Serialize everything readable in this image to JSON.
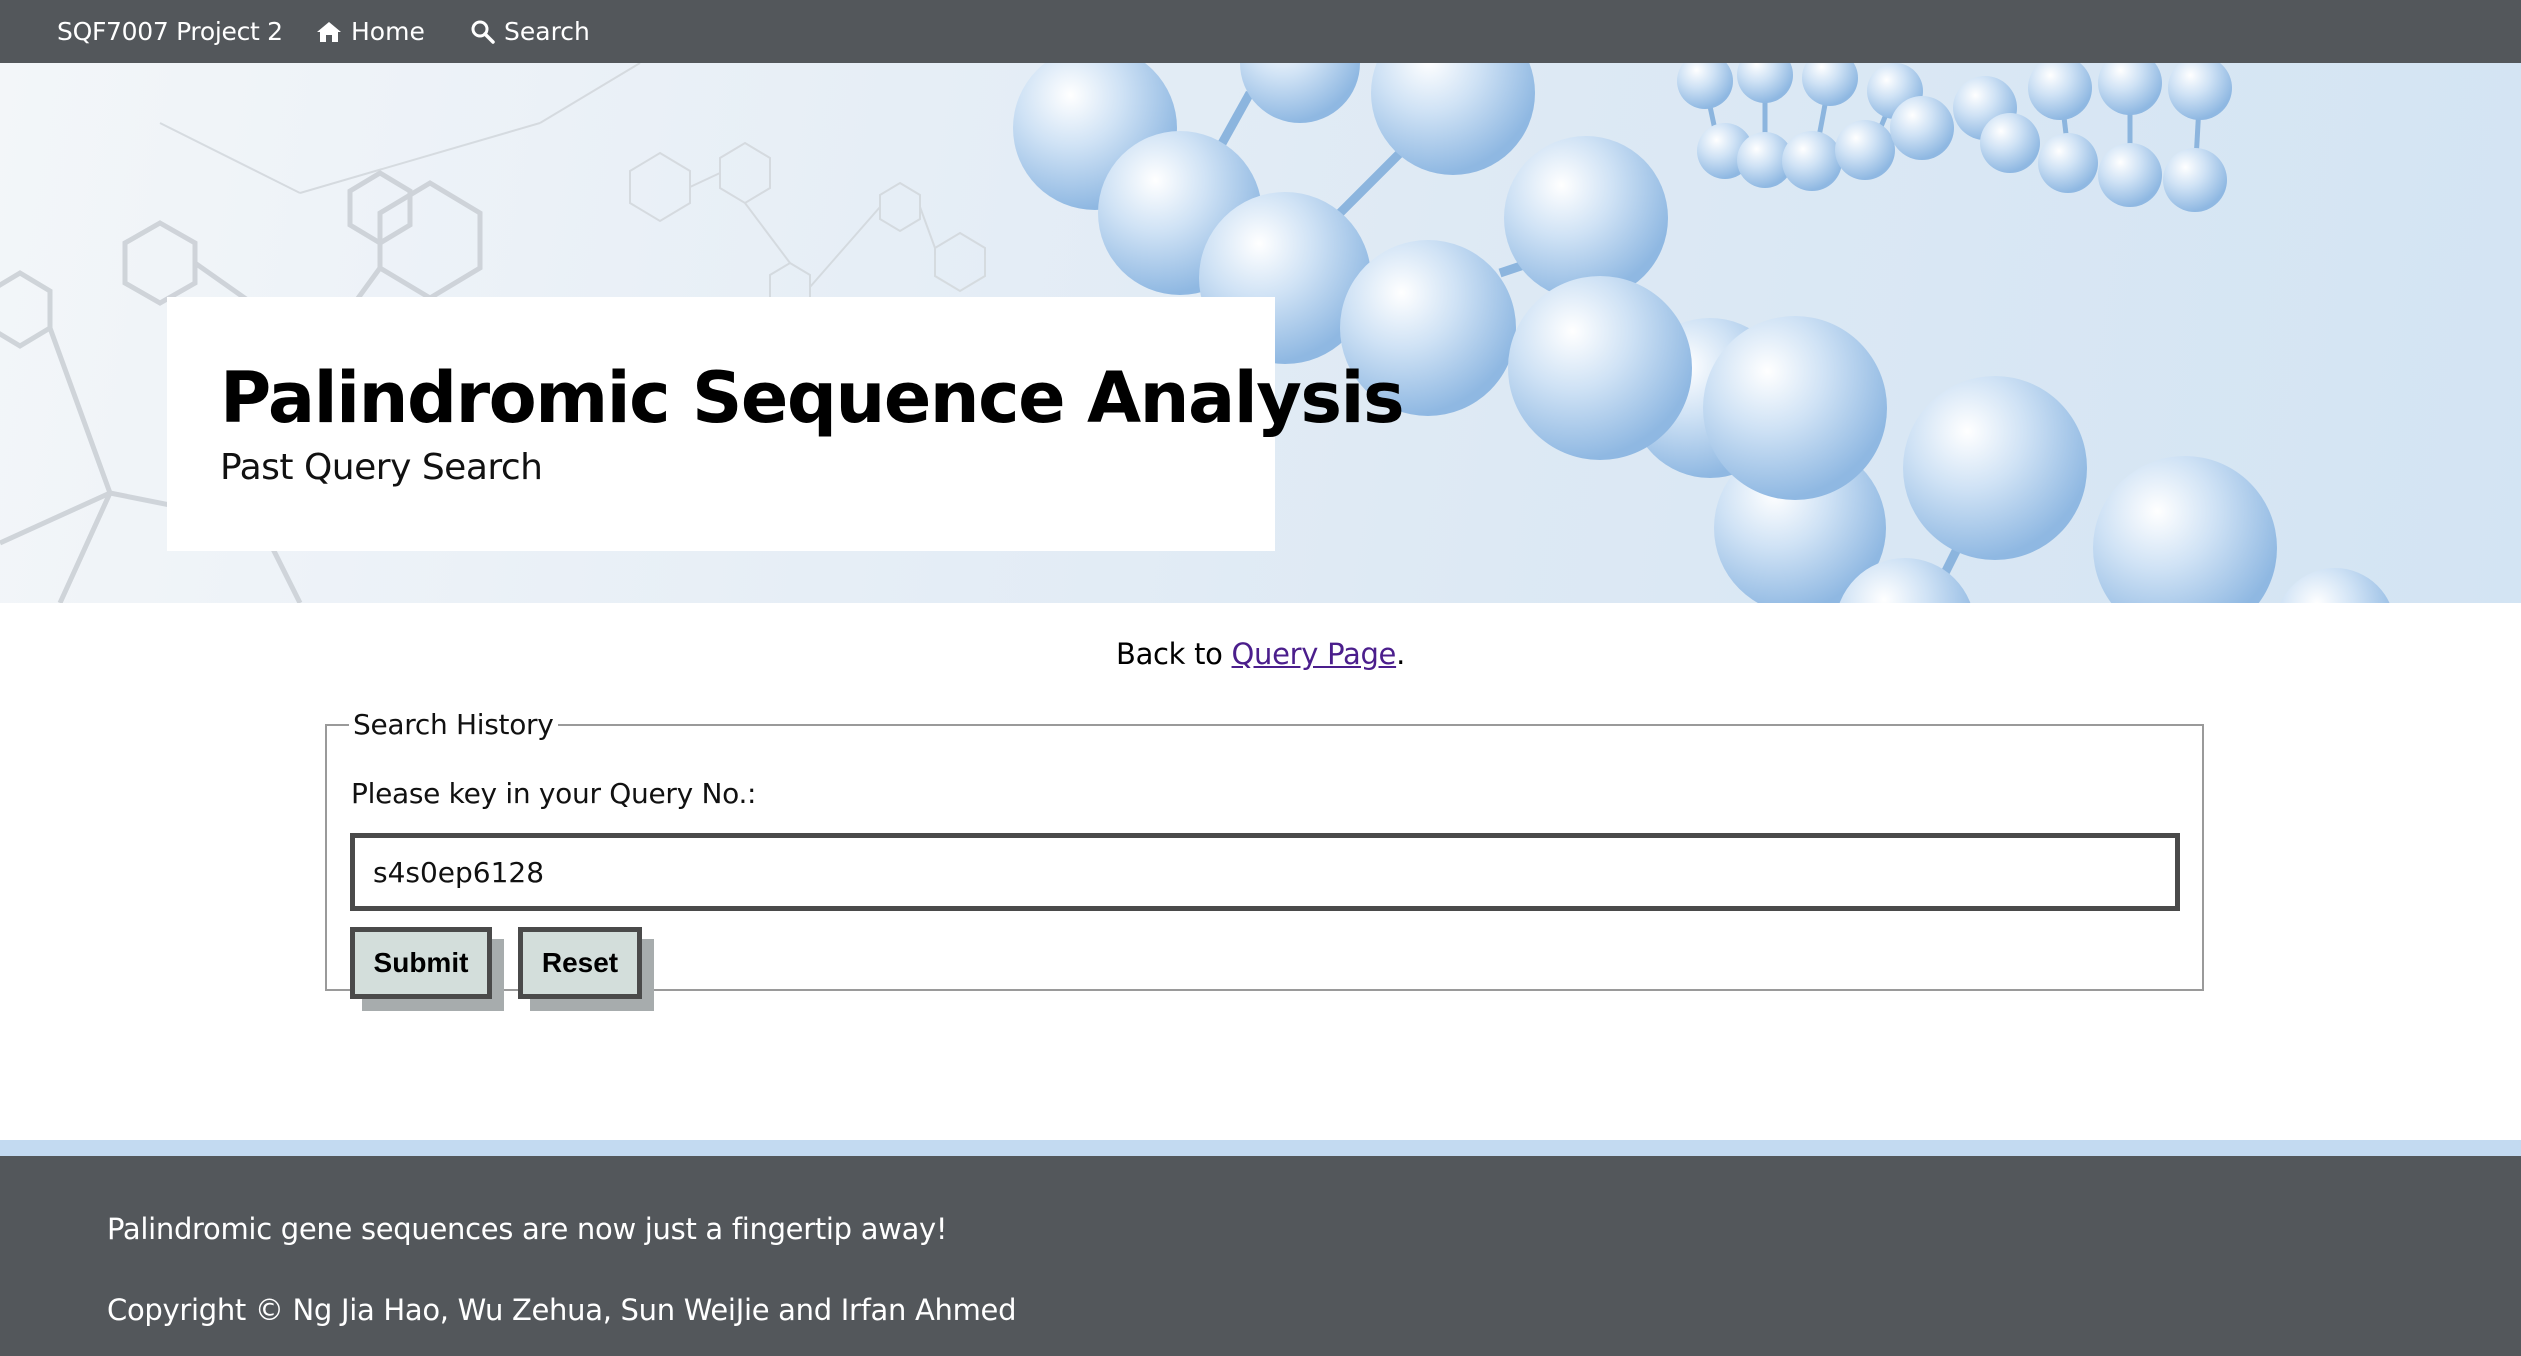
{
  "nav": {
    "brand": "SQF7007 Project 2",
    "home_label": "Home",
    "search_label": "Search"
  },
  "hero": {
    "title": "Palindromic Sequence Analysis",
    "subtitle": "Past Query Search"
  },
  "back": {
    "prefix": "Back to ",
    "link_text": "Query Page",
    "suffix": "."
  },
  "search_history": {
    "legend": "Search History",
    "label": "Please key in your Query No.:",
    "query_value": "s4s0ep6128",
    "submit_label": "Submit",
    "reset_label": "Reset"
  },
  "footer": {
    "tagline": "Palindromic gene sequences are now just a fingertip away!",
    "copyright": "Copyright © Ng Jia Hao, Wu Zehua, Sun WeiJie and Irfan Ahmed"
  },
  "icons": {
    "home": "home-icon",
    "search": "search-icon"
  },
  "colors": {
    "nav_bg": "#53575b",
    "footer_bg": "#53575b",
    "footer_accent": "#c3daf1",
    "link": "#4b1e8c",
    "button_bg": "#d3dedb"
  }
}
